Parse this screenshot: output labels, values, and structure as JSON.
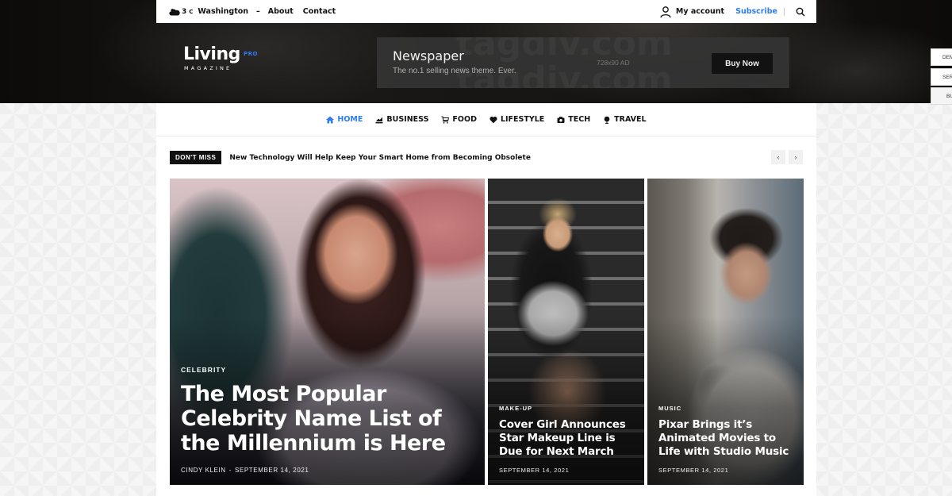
{
  "topbar": {
    "weather_icon": "cloud-icon",
    "temperature": "3",
    "temperature_unit": "C",
    "location": "Washington",
    "separator": "–",
    "links": [
      {
        "label": "About"
      },
      {
        "label": "Contact"
      }
    ],
    "account_icon": "user-icon",
    "account_label": "My account",
    "subscribe_label": "Subscribe",
    "search_icon": "search-icon"
  },
  "logo": {
    "word": "Living",
    "badge": "PRO",
    "subtitle": "MAGAZINE"
  },
  "ad": {
    "watermark": "tagdiv.com",
    "title": "Newspaper",
    "tagline": "The no.1 selling news theme. Ever.",
    "size_label": "728x90 AD",
    "button_label": "Buy Now"
  },
  "side_tabs": [
    {
      "label": "DEMOS"
    },
    {
      "label": "SERVICES"
    },
    {
      "label": "BUY"
    }
  ],
  "nav": {
    "items": [
      {
        "label": "HOME",
        "icon": "home-icon",
        "active": true
      },
      {
        "label": "BUSINESS",
        "icon": "chart-icon",
        "active": false
      },
      {
        "label": "FOOD",
        "icon": "cart-icon",
        "active": false
      },
      {
        "label": "LIFESTYLE",
        "icon": "heart-icon",
        "active": false
      },
      {
        "label": "TECH",
        "icon": "camera-icon",
        "active": false
      },
      {
        "label": "TRAVEL",
        "icon": "globe-icon",
        "active": false
      }
    ]
  },
  "ticker": {
    "badge": "DON'T MISS",
    "headline": "New Technology Will Help Keep Your Smart Home from Becoming Obsolete",
    "prev_label": "‹",
    "next_label": "›"
  },
  "featured": [
    {
      "category": "CELEBRITY",
      "title": "The Most Popular Celebrity Name List of the Millennium is Here",
      "author": "CINDY KLEIN",
      "meta_separator": "-",
      "date": "SEPTEMBER 14, 2021"
    },
    {
      "category": "MAKE-UP",
      "title": "Cover Girl Announces Star Makeup Line is Due for Next March",
      "date": "SEPTEMBER 14, 2021"
    },
    {
      "category": "MUSIC",
      "title": "Pixar Brings it’s Animated Movies to Life with Studio Music",
      "date": "SEPTEMBER 14, 2021"
    }
  ],
  "colors": {
    "accent": "#2d7df0",
    "header_bg": "#121110",
    "badge_bg": "#111111"
  }
}
